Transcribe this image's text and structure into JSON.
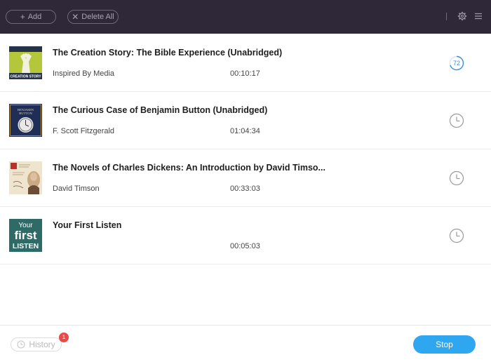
{
  "toolbar": {
    "add_icon": "plus-icon",
    "add_label": "Add",
    "delete_icon": "x-icon",
    "delete_label": "Delete All",
    "settings_icon": "gear-icon",
    "menu_icon": "hamburger-menu-icon"
  },
  "items": [
    {
      "title": "The Creation Story: The Bible Experience (Unabridged)",
      "author": "Inspired By Media",
      "duration": "00:10:17",
      "status": "progress",
      "progress": "72",
      "cover_text_1": "CREATION STORY"
    },
    {
      "title": "The Curious Case of Benjamin Button (Unabridged)",
      "author": "F. Scott Fitzgerald",
      "duration": "01:04:34",
      "status": "queued",
      "cover_text_1": "BENJAMIN",
      "cover_text_2": "BUTTON"
    },
    {
      "title": "The Novels of Charles Dickens: An Introduction by David Timso...",
      "author": "David Timson",
      "duration": "00:33:03",
      "status": "queued"
    },
    {
      "title": "Your First Listen",
      "author": "",
      "duration": "00:05:03",
      "status": "queued",
      "cover_text_1": "Your",
      "cover_text_2": "first",
      "cover_text_3": "LISTEN"
    }
  ],
  "footer": {
    "history_icon": "clock-icon",
    "history_label": "History",
    "history_badge": "1",
    "stop_label": "Stop"
  },
  "colors": {
    "topbar": "#2e2838",
    "accent": "#2ea7f0",
    "badge": "#e84a4a"
  }
}
